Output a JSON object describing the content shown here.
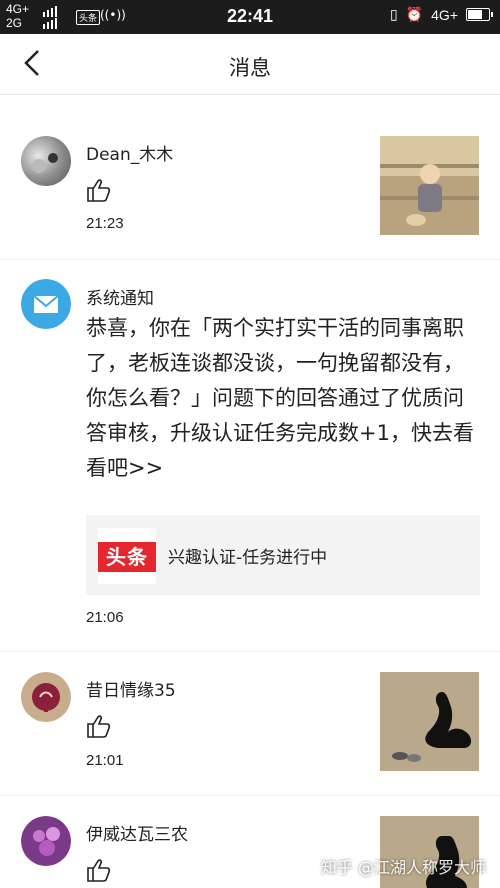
{
  "status_bar": {
    "net_top": "4G+",
    "net_bottom": "2G",
    "badge": "头条",
    "time": "22:41",
    "net_right": "4G+",
    "colors": {
      "bg": "#1c1c1c",
      "fg": "#ffffff"
    }
  },
  "nav": {
    "title": "消息"
  },
  "messages": [
    {
      "user": "Dean_木木",
      "time": "21:23",
      "icon": "thumbs-up-icon"
    },
    {
      "user": "系统通知",
      "text": "恭喜，你在「两个实打实干活的同事离职了，老板连谈都没谈，一句挽留都没有，你怎么看？」问题下的回答通过了优质问答审核，升级认证任务完成数+1，快去看看吧>>",
      "card": {
        "logo": "头条",
        "text": "兴趣认证-任务进行中"
      },
      "time": "21:06",
      "icon": "mail-icon"
    },
    {
      "user": "昔日情缘35",
      "time": "21:01",
      "icon": "thumbs-up-icon"
    },
    {
      "user": "伊威达瓦三农",
      "icon": "thumbs-up-icon"
    }
  ],
  "watermark": "知乎 @江湖人称罗大师",
  "colors": {
    "accent_blue": "#3ba9e4",
    "brand_red": "#e6262e",
    "card_bg": "#f3f3f3"
  }
}
